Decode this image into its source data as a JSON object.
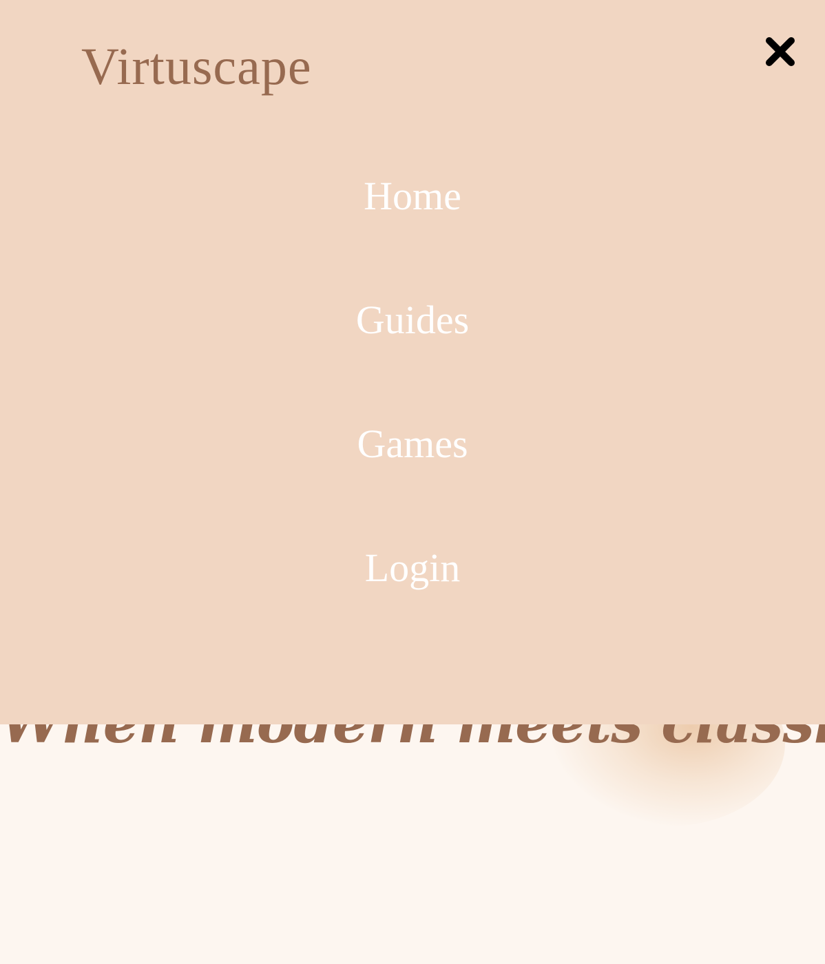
{
  "brand": {
    "name": "Virtuscape"
  },
  "hero": {
    "tagline": "When modern meets classic"
  },
  "menu": {
    "close_icon": "close-icon",
    "items": [
      {
        "label": "Home"
      },
      {
        "label": "Guides"
      },
      {
        "label": "Games"
      },
      {
        "label": "Login"
      }
    ]
  },
  "colors": {
    "menu_background": "#f1d6c2",
    "page_background": "#fdf6f0",
    "brand_text": "#976a50",
    "menu_text": "#ffffff",
    "close_icon": "#000000"
  }
}
